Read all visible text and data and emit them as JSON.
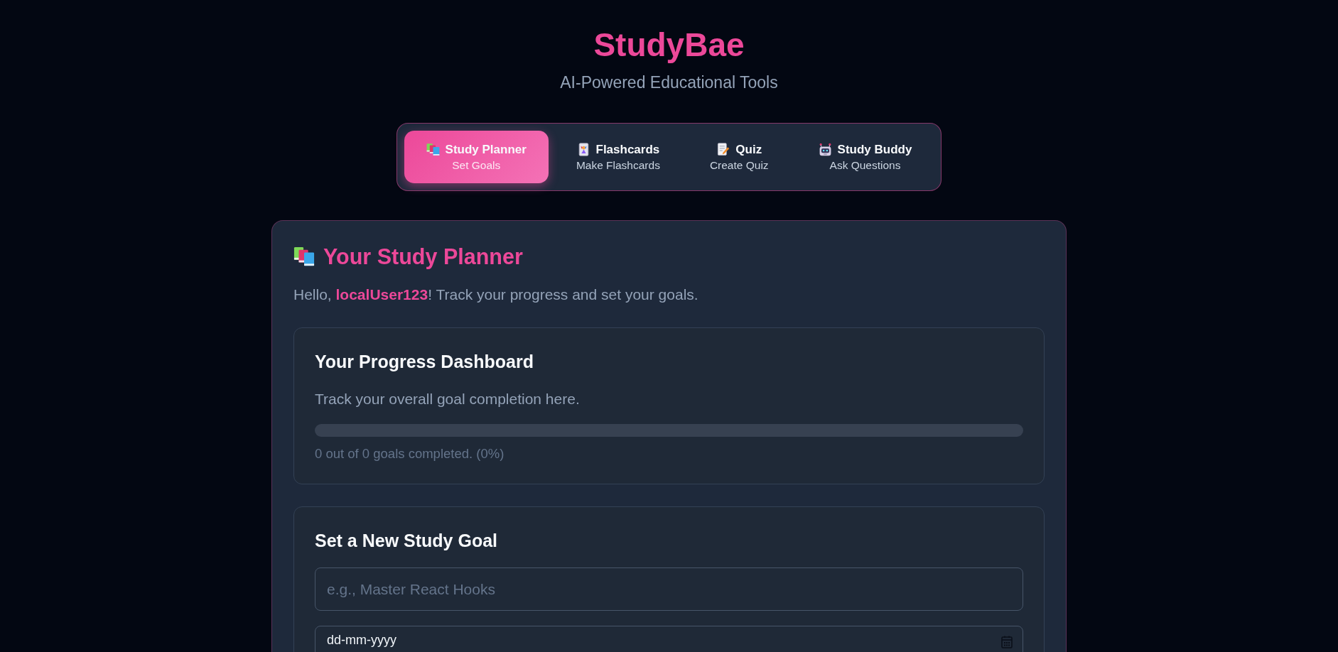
{
  "header": {
    "title": "StudyBae",
    "subtitle": "AI-Powered Educational Tools"
  },
  "tabs": [
    {
      "label": "Study Planner",
      "caption": "Set Goals",
      "selected": true
    },
    {
      "label": "Flashcards",
      "caption": "Make Flashcards",
      "selected": false
    },
    {
      "label": "Quiz",
      "caption": "Create Quiz",
      "selected": false
    },
    {
      "label": "Study Buddy",
      "caption": "Ask Questions",
      "selected": false
    }
  ],
  "planner": {
    "title": "Your Study Planner",
    "greeting": "Hello, **localUser123**! Track your progress and set your goals.",
    "dashboard": {
      "title": "Your Progress Dashboard",
      "description": "Track your overall goal completion here.",
      "progress": {
        "level": 0
      },
      "summary": "0 out of 0 goals completed. (0%)"
    },
    "goal_form": {
      "title": "Set a New Study Goal",
      "goal_field": {
        "placeholder": "e.g., Master React Hooks"
      },
      "date_field": {
        "placeholder": "dd-mm-yyyy"
      }
    }
  }
}
